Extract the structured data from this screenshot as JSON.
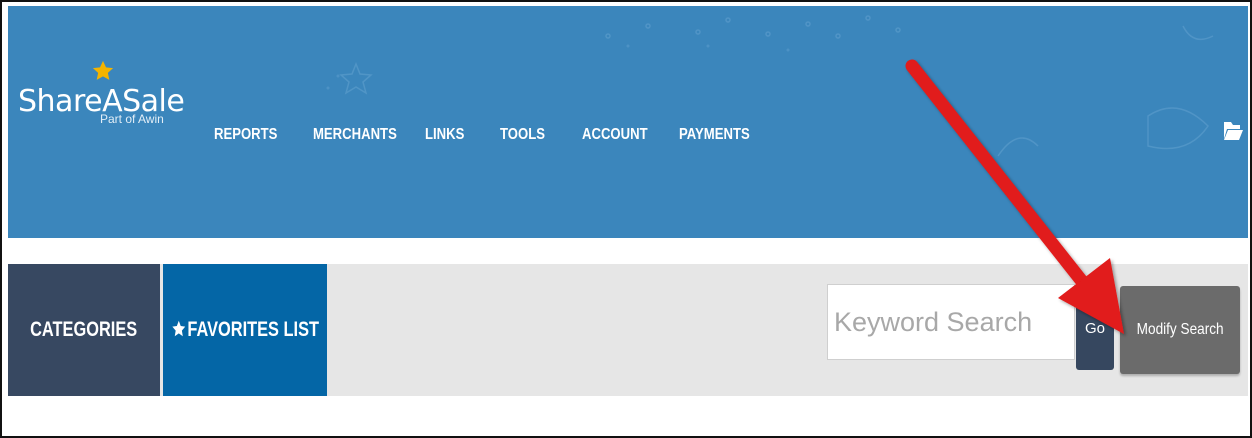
{
  "brand": {
    "name": "ShareASale",
    "tagline": "Part of Awin",
    "star_color": "#f4b400"
  },
  "nav": {
    "items": [
      {
        "label": "REPORTS"
      },
      {
        "label": "MERCHANTS"
      },
      {
        "label": "LINKS"
      },
      {
        "label": "TOOLS"
      },
      {
        "label": "ACCOUNT"
      },
      {
        "label": "PAYMENTS"
      }
    ]
  },
  "toolbar": {
    "categories_label": "CATEGORIES",
    "favorites_label": "FAVORITES LIST",
    "search_placeholder": "Keyword Search",
    "search_value": "",
    "go_label": "Go",
    "modify_label": "Modify Search"
  },
  "icons": {
    "header_right": "folder-icon",
    "favorites": "star-icon",
    "logo": "star-icon"
  },
  "colors": {
    "header_bg": "#3b86bc",
    "categories_bg": "#374861",
    "favorites_bg": "#0466a6",
    "go_bg": "#36475f",
    "modify_bg": "#6b6b6b",
    "annotation_arrow": "#e11a1a"
  }
}
